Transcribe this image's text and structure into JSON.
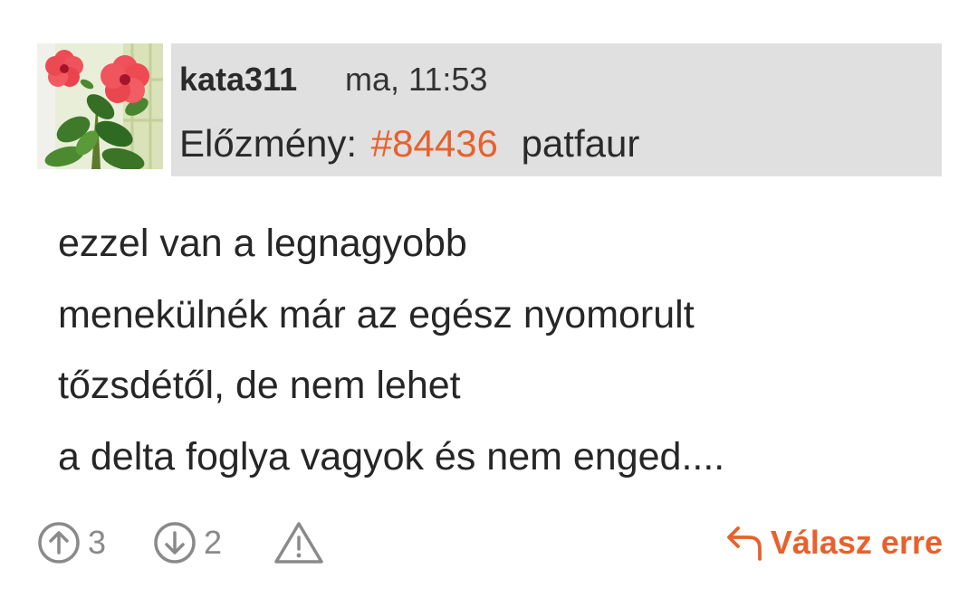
{
  "post": {
    "username": "kata311",
    "timestamp": "ma, 11:53",
    "history_label": "Előzmény:",
    "history_ref": "#84436",
    "history_user": "patfaur",
    "body_lines": [
      "ezzel van a legnagyobb",
      "menekülnék már az egész nyomorult",
      "tőzsdétől, de nem lehet",
      "a delta foglya vagyok és nem enged...."
    ]
  },
  "actions": {
    "upvotes": "3",
    "downvotes": "2",
    "reply_label": "Válasz erre"
  },
  "colors": {
    "accent": "#e8612c",
    "header_bg": "#e0e0e0",
    "icon_gray": "#8a8a8a"
  },
  "icons": {
    "upvote": "arrow-up-circle-icon",
    "downvote": "arrow-down-circle-icon",
    "report": "warning-triangle-icon",
    "reply": "reply-arrow-icon"
  }
}
